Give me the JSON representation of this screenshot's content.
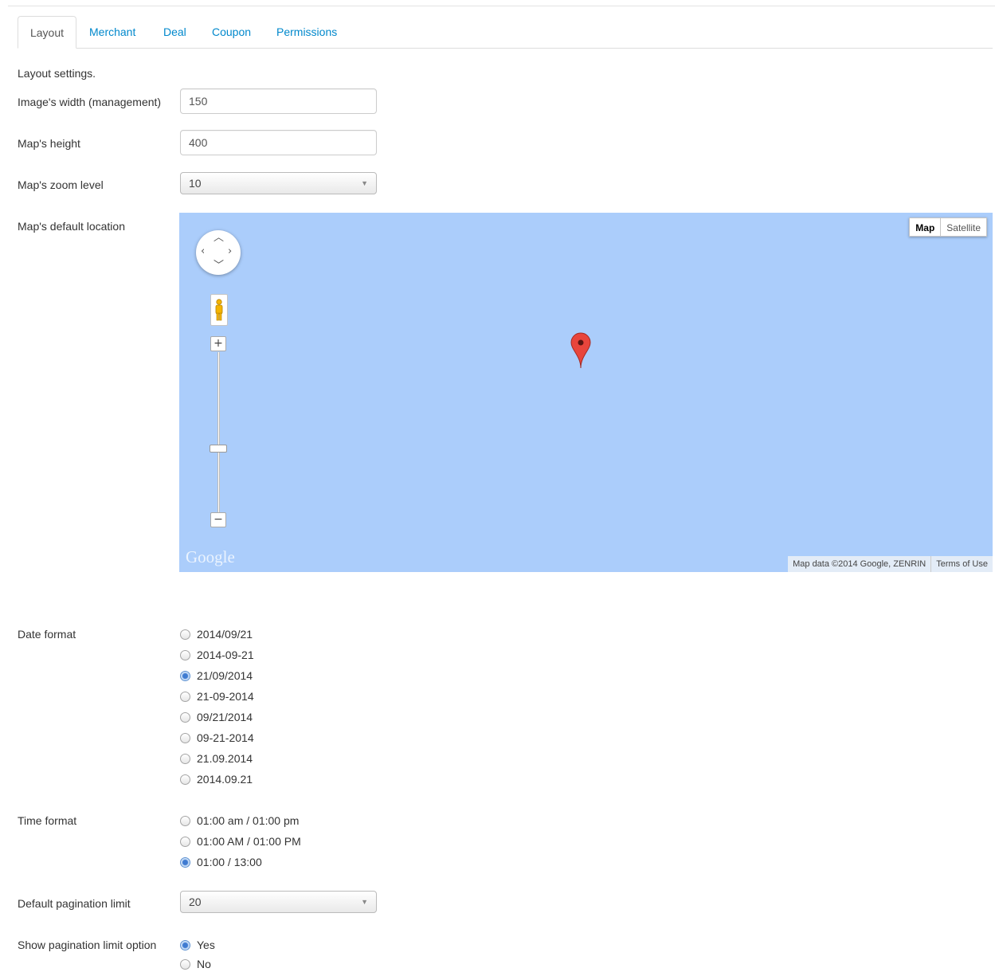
{
  "tabs": [
    {
      "label": "Layout",
      "active": true
    },
    {
      "label": "Merchant",
      "active": false
    },
    {
      "label": "Deal",
      "active": false
    },
    {
      "label": "Coupon",
      "active": false
    },
    {
      "label": "Permissions",
      "active": false
    }
  ],
  "intro": "Layout settings.",
  "fields": {
    "image_width": {
      "label": "Image's width (management)",
      "value": "150"
    },
    "map_height": {
      "label": "Map's height",
      "value": "400"
    },
    "map_zoom": {
      "label": "Map's zoom level",
      "value": "10"
    },
    "map_location": {
      "label": "Map's default location"
    },
    "date_format": {
      "label": "Date format",
      "options": [
        "2014/09/21",
        "2014-09-21",
        "21/09/2014",
        "21-09-2014",
        "09/21/2014",
        "09-21-2014",
        "21.09.2014",
        "2014.09.21"
      ],
      "selected": "21/09/2014"
    },
    "time_format": {
      "label": "Time format",
      "options": [
        "01:00 am / 01:00 pm",
        "01:00 AM / 01:00 PM",
        "01:00 / 13:00"
      ],
      "selected": "01:00 / 13:00"
    },
    "pagination_limit": {
      "label": "Default pagination limit",
      "value": "20"
    },
    "show_pagination": {
      "label": "Show pagination limit option",
      "options": [
        "Yes",
        "No"
      ],
      "selected": "Yes"
    }
  },
  "map": {
    "type_buttons": {
      "map": "Map",
      "satellite": "Satellite",
      "selected": "Map"
    },
    "zoom_in": "+",
    "zoom_out": "−",
    "logo": "Google",
    "attribution": "Map data ©2014 Google, ZENRIN",
    "terms": "Terms of Use",
    "water_color": "#abcdfb",
    "marker_color": "#e8453c"
  },
  "colors": {
    "link": "#0088cc",
    "radio_checked": "#3f7bd1"
  }
}
